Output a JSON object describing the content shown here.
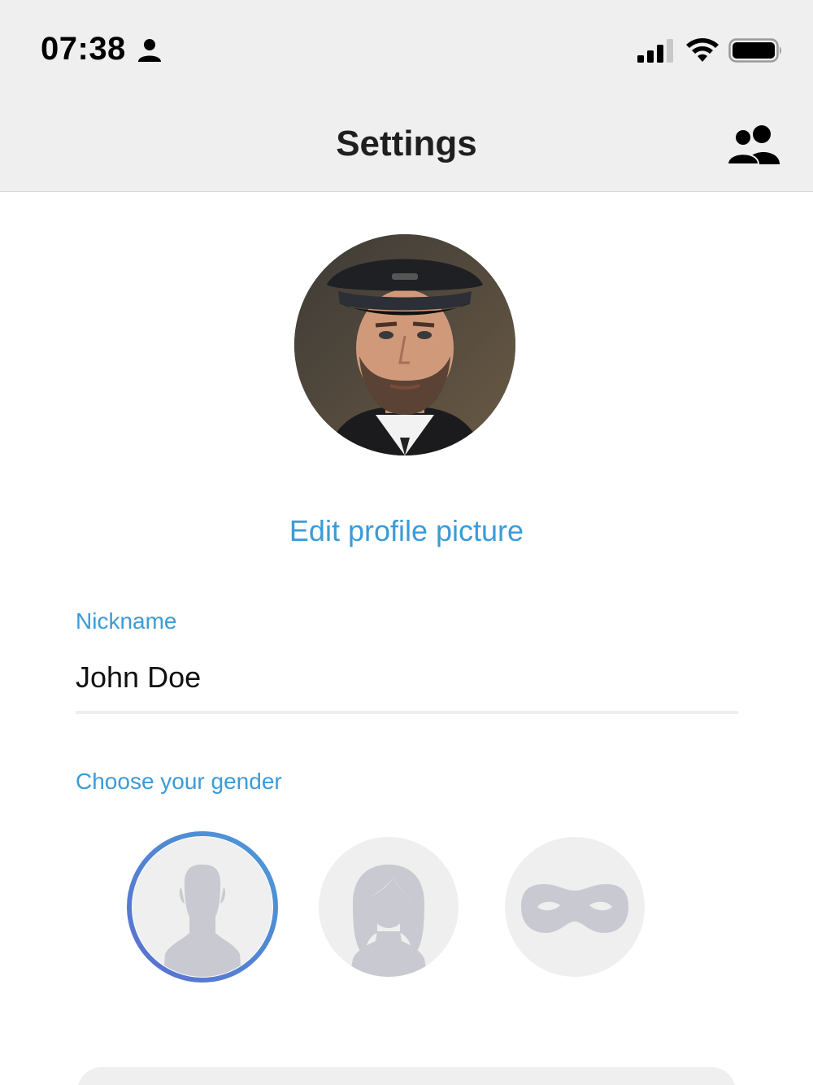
{
  "status_bar": {
    "time": "07:38",
    "icons": [
      "person-icon",
      "cellular-signal-icon",
      "wifi-icon",
      "battery-icon"
    ]
  },
  "nav": {
    "title": "Settings",
    "right_icon": "contacts-icon"
  },
  "profile": {
    "avatar": "profile-photo",
    "edit_label": "Edit profile picture"
  },
  "nickname": {
    "label": "Nickname",
    "value": "John Doe"
  },
  "gender": {
    "label": "Choose your gender",
    "options": [
      {
        "name": "male",
        "icon": "male-silhouette-icon",
        "selected": true
      },
      {
        "name": "female",
        "icon": "female-silhouette-icon",
        "selected": false
      },
      {
        "name": "anonymous",
        "icon": "mask-icon",
        "selected": false
      }
    ]
  },
  "colors": {
    "accent": "#3b9bd8",
    "header_bg": "#efefef",
    "placeholder_icon": "#c9c9d1",
    "ring_gradient": [
      "#5b6fd0",
      "#4a9ad8"
    ]
  }
}
